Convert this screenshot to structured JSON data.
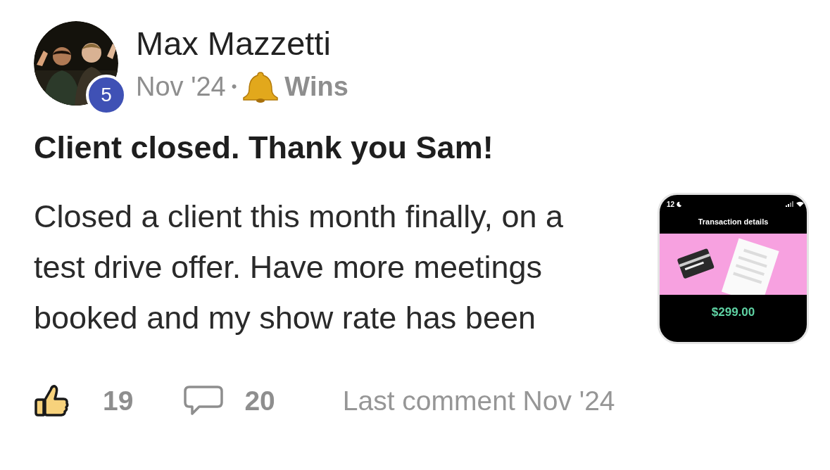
{
  "post": {
    "author": "Max Mazzetti",
    "level": "5",
    "date": "Nov '24",
    "separator": "•",
    "category": "Wins",
    "title": "Client closed. Thank you Sam!",
    "body": "Closed a client this month finally, on a test drive offer. Have more meetings booked and my show rate has been",
    "attachment": {
      "status_time": "12",
      "header": "Transaction details",
      "amount": "$299.00"
    },
    "likes": {
      "count": "19",
      "liked": false
    },
    "comments": {
      "count": "20"
    },
    "last_comment": "Last comment Nov '24"
  }
}
